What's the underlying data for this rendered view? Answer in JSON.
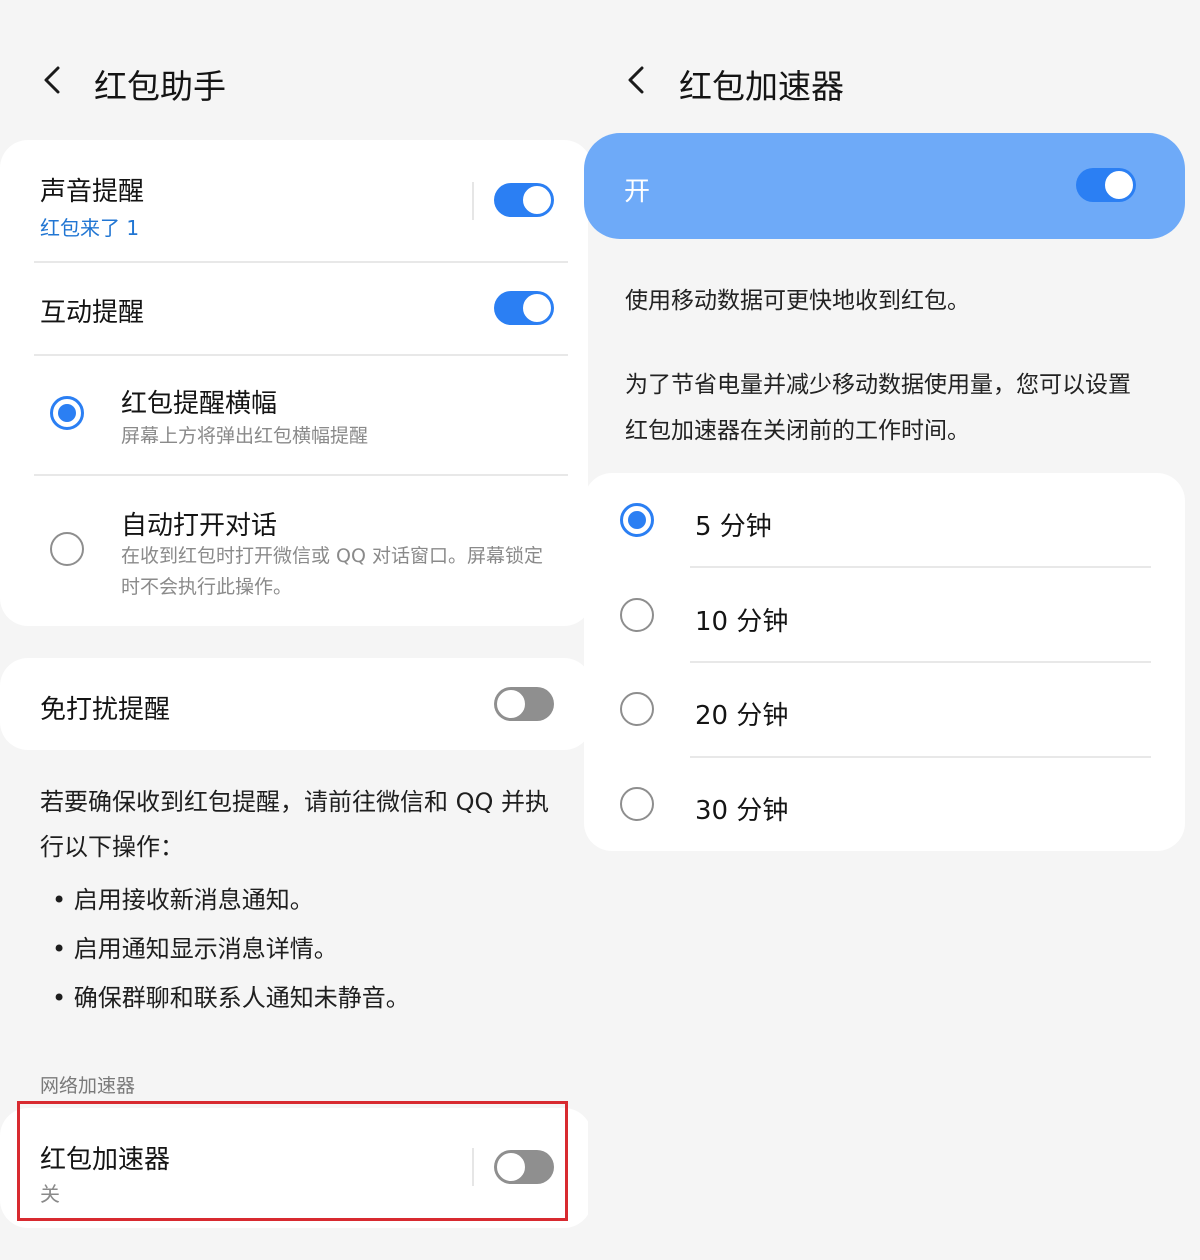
{
  "left": {
    "title": "红包助手",
    "card1": {
      "sound": {
        "title": "声音提醒",
        "subtitle": "红包来了 1",
        "enabled": true
      },
      "interactive": {
        "title": "互动提醒",
        "enabled": true
      },
      "banner": {
        "title": "红包提醒横幅",
        "description": "屏幕上方将弹出红包横幅提醒",
        "selected": true
      },
      "auto_open": {
        "title": "自动打开对话",
        "description": "在收到红包时打开微信或 QQ 对话窗口。屏幕锁定时不会执行此操作。",
        "selected": false
      }
    },
    "dnd": {
      "title": "免打扰提醒",
      "enabled": false
    },
    "info": {
      "intro": "若要确保收到红包提醒，请前往微信和 QQ 并执行以下操作：",
      "bullets": [
        "• 启用接收新消息通知。",
        "• 启用通知显示消息详情。",
        "• 确保群聊和联系人通知未静音。"
      ]
    },
    "section_header": "网络加速器",
    "accelerator": {
      "title": "红包加速器",
      "status": "关",
      "enabled": false
    }
  },
  "right": {
    "title": "红包加速器",
    "master": {
      "label": "开",
      "enabled": true
    },
    "desc1": "使用移动数据可更快地收到红包。",
    "desc2": "为了节省电量并减少移动数据使用量，您可以设置红包加速器在关闭前的工作时间。",
    "options": [
      {
        "label": "5 分钟",
        "selected": true
      },
      {
        "label": "10 分钟",
        "selected": false
      },
      {
        "label": "20 分钟",
        "selected": false
      },
      {
        "label": "30 分钟",
        "selected": false
      }
    ]
  },
  "colors": {
    "accent": "#2b7ff3",
    "master_bar": "#6eaaf8",
    "subtitle_blue": "#2176d3",
    "highlight_red": "#d82a30",
    "background": "#f5f5f5",
    "card": "#ffffff"
  },
  "icons": {
    "back": "chevron-left-icon"
  }
}
